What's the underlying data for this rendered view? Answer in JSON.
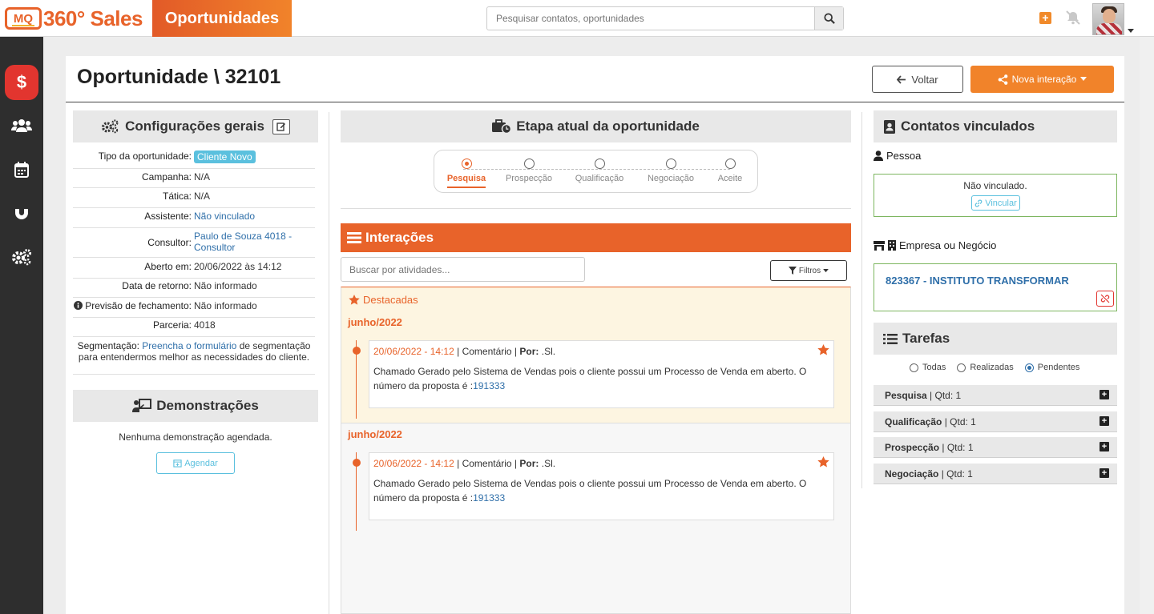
{
  "brand": {
    "logo_badge": "MQ",
    "logo_text": "360° Sales"
  },
  "header": {
    "page_tag": "Oportunidades",
    "search_placeholder": "Pesquisar contatos, oportunidades"
  },
  "sidebar": {
    "items": [
      {
        "name": "dollar",
        "label": "$"
      },
      {
        "name": "users"
      },
      {
        "name": "calendar"
      },
      {
        "name": "magnet"
      },
      {
        "name": "settings"
      }
    ]
  },
  "page": {
    "title": "Oportunidade \\ 32101",
    "back_label": "Voltar",
    "new_interaction_label": "Nova interação"
  },
  "config": {
    "title": "Configurações gerais",
    "rows": [
      {
        "label": "Tipo da oportunidade:",
        "value": "Cliente Novo"
      },
      {
        "label": "Campanha:",
        "value": "N/A"
      },
      {
        "label": "Tática:",
        "value": "N/A"
      },
      {
        "label": "Assistente:",
        "value": "Não vinculado"
      },
      {
        "label": "Consultor:",
        "value": "Paulo de Souza 4018 - Consultor"
      },
      {
        "label": "Aberto em:",
        "value": "20/06/2022 às 14:12"
      },
      {
        "label": "Data de retorno:",
        "value": "Não informado"
      },
      {
        "label": "Previsão de fechamento:",
        "value": "Não informado"
      },
      {
        "label": "Parceria:",
        "value": "4018"
      }
    ],
    "segmentation": {
      "label": "Segmentação:",
      "link": "Preencha o formulário",
      "text_after": "de segmentação para entendermos melhor as necessidades do cliente."
    }
  },
  "demos": {
    "title": "Demonstrações",
    "empty": "Nenhuma demonstração agendada.",
    "schedule_label": "Agendar"
  },
  "stage": {
    "title": "Etapa atual da oportunidade",
    "steps": [
      "Pesquisa",
      "Prospecção",
      "Qualificação",
      "Negociação",
      "Aceite"
    ],
    "active": "Pesquisa"
  },
  "interactions": {
    "title": "Interações",
    "search_placeholder": "Buscar por atividades...",
    "filter_label": "Filtros",
    "highlight_title": "Destacadas",
    "groups": [
      {
        "month": "junho/2022",
        "card": {
          "date": "20/06/2022 - 14:12",
          "type": "Comentário",
          "by_label": "Por:",
          "by": ".Sl.",
          "text": "Chamado Gerado pelo Sistema de Vendas pois o cliente possui um Processo de Venda em aberto. O número da proposta é :",
          "link": "191333"
        }
      },
      {
        "month": "junho/2022",
        "card": {
          "date": "20/06/2022 - 14:12",
          "type": "Comentário",
          "by_label": "Por:",
          "by": ".Sl.",
          "text": "Chamado Gerado pelo Sistema de Vendas pois o cliente possui um Processo de Venda em aberto. O número da proposta é :",
          "link": "191333"
        }
      }
    ]
  },
  "contacts": {
    "title": "Contatos vinculados",
    "person_label": "Pessoa",
    "person_empty": "Não vinculado.",
    "link_label": "Vincular",
    "company_label": "Empresa ou Negócio",
    "company_value": "823367 - INSTITUTO TRANSFORMAR"
  },
  "tasks": {
    "title": "Tarefas",
    "filters": [
      "Todas",
      "Realizadas",
      "Pendentes"
    ],
    "selected": "Pendentes",
    "rows": [
      {
        "name": "Pesquisa",
        "qty": "| Qtd: 1"
      },
      {
        "name": "Qualificação",
        "qty": "| Qtd: 1"
      },
      {
        "name": "Prospecção",
        "qty": "| Qtd: 1"
      },
      {
        "name": "Negociação",
        "qty": "| Qtd: 1"
      }
    ]
  },
  "colors": {
    "accent": "#e8632a",
    "danger": "#e2352f",
    "link": "#2f6fa9",
    "info": "#5bc0de"
  }
}
